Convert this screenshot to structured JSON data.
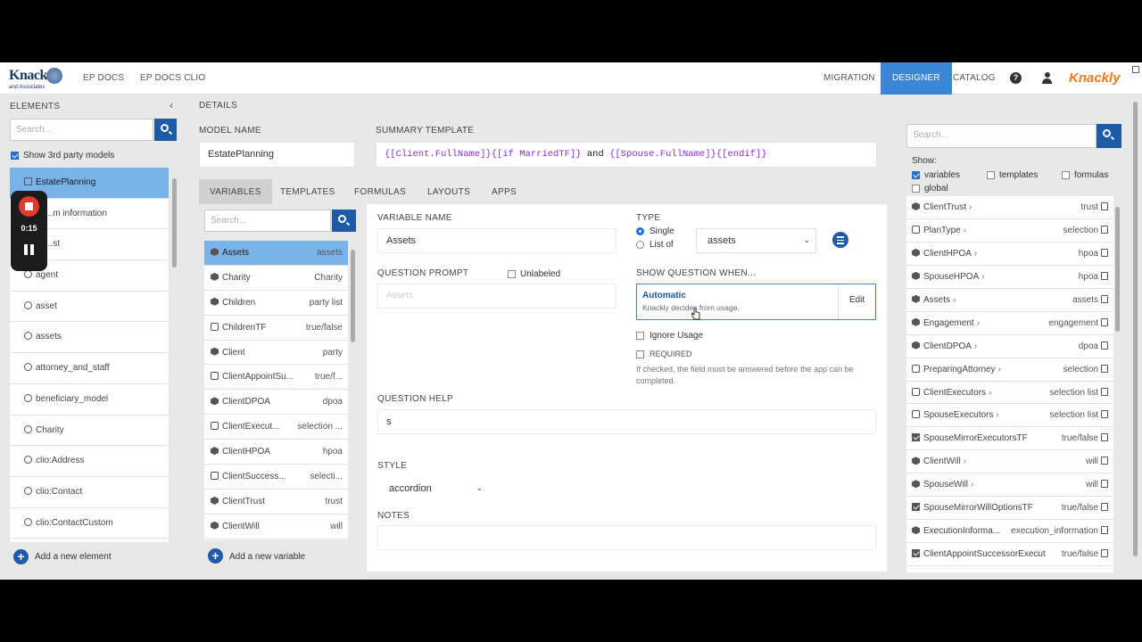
{
  "nav": {
    "logo_main": "Knack",
    "logo_sub": "and Associates",
    "links": [
      "EP DOCS",
      "EP DOCS CLIO"
    ],
    "right_links": [
      "MIGRATION",
      "DESIGNER",
      "CATALOG"
    ],
    "brand": "Knackly"
  },
  "left": {
    "title": "ELEMENTS",
    "collapse": "‹",
    "search_placeholder": "Search...",
    "show_3rd_party": "Show 3rd party models",
    "items": [
      {
        "label": "EstatePlanning",
        "icon": "table-icon"
      },
      {
        "label": "...m information",
        "icon": "circle-icon"
      },
      {
        "label": "...st",
        "icon": "circle-icon"
      },
      {
        "label": "agent",
        "icon": "circle-icon"
      },
      {
        "label": "asset",
        "icon": "circle-icon"
      },
      {
        "label": "assets",
        "icon": "circle-icon"
      },
      {
        "label": "attorney_and_staff",
        "icon": "circle-icon"
      },
      {
        "label": "beneficiary_model",
        "icon": "circle-icon"
      },
      {
        "label": "Charity",
        "icon": "circle-icon"
      },
      {
        "label": "clio:Address",
        "icon": "circle-icon"
      },
      {
        "label": "clio:Contact",
        "icon": "circle-icon"
      },
      {
        "label": "clio:ContactCustom",
        "icon": "circle-icon"
      }
    ],
    "add_label": "Add a new element"
  },
  "recorder": {
    "time": "0:15"
  },
  "details": {
    "title": "DETAILS",
    "model_name_label": "MODEL NAME",
    "model_name": "EstatePlanning",
    "summary_label": "SUMMARY TEMPLATE",
    "summary_parts": [
      "{[Client.FullName]}",
      "{[if MarriedTF]}",
      " and ",
      "{[Spouse.FullName]}",
      "{[endif]}"
    ],
    "expand": "›"
  },
  "tabs": [
    "VARIABLES",
    "TEMPLATES",
    "FORMULAS",
    "LAYOUTS",
    "APPS"
  ],
  "variables": {
    "search_placeholder": "Search...",
    "items": [
      {
        "name": "Assets",
        "type": "assets",
        "icon": "cube"
      },
      {
        "name": "Charity",
        "type": "Charity",
        "icon": "cube"
      },
      {
        "name": "Children",
        "type": "party list",
        "icon": "cube"
      },
      {
        "name": "ChildrenTF",
        "type": "true/false",
        "icon": "square"
      },
      {
        "name": "Client",
        "type": "party",
        "icon": "cube"
      },
      {
        "name": "ClientAppointSu...",
        "type": "true/f...",
        "icon": "square"
      },
      {
        "name": "ClientDPOA",
        "type": "dpoa",
        "icon": "cube"
      },
      {
        "name": "ClientExecut...",
        "type": "selection ...",
        "icon": "square"
      },
      {
        "name": "ClientHPOA",
        "type": "hpoa",
        "icon": "cube"
      },
      {
        "name": "ClientSuccess...",
        "type": "selecti...",
        "icon": "square"
      },
      {
        "name": "ClientTrust",
        "type": "trust",
        "icon": "cube"
      },
      {
        "name": "ClientWill",
        "type": "will",
        "icon": "cube"
      }
    ],
    "add_label": "Add a new variable"
  },
  "editor": {
    "var_name_label": "VARIABLE NAME",
    "var_name": "Assets",
    "type_label": "TYPE",
    "type_single": "Single",
    "type_list": "List of",
    "type_value": "assets",
    "prompt_label": "QUESTION PROMPT",
    "unlabeled": "Unlabeled",
    "prompt_placeholder": "Assets",
    "show_when_label": "SHOW QUESTION WHEN...",
    "auto_title": "Automatic",
    "auto_sub": "Knackly decides from usage.",
    "edit": "Edit",
    "ignore_usage": "Ignore Usage",
    "required": "REQUIRED",
    "required_hint": "If checked, the field must be answered before the app can be completed.",
    "help_label": "QUESTION HELP",
    "help_value": "s",
    "style_label": "STYLE",
    "style_value": "accordion",
    "notes_label": "NOTES"
  },
  "right": {
    "search_placeholder": "Search...",
    "show_label": "Show:",
    "opts": [
      "variables",
      "templates",
      "formulas",
      "global"
    ],
    "items": [
      {
        "name": "ClientTrust",
        "type": "trust",
        "icon": "cube",
        "chev": true
      },
      {
        "name": "PlanType",
        "type": "selection",
        "icon": "square",
        "chev": true
      },
      {
        "name": "ClientHPOA",
        "type": "hpoa",
        "icon": "cube",
        "chev": true
      },
      {
        "name": "SpouseHPOA",
        "type": "hpoa",
        "icon": "cube",
        "chev": true
      },
      {
        "name": "Assets",
        "type": "assets",
        "icon": "cube",
        "chev": true
      },
      {
        "name": "Engagement",
        "type": "engagement",
        "icon": "cube",
        "chev": true
      },
      {
        "name": "ClientDPOA",
        "type": "dpoa",
        "icon": "cube",
        "chev": true
      },
      {
        "name": "PreparingAttorney",
        "type": "selection",
        "icon": "square",
        "chev": true
      },
      {
        "name": "ClientExecutors",
        "type": "selection list",
        "icon": "square",
        "chev": true
      },
      {
        "name": "SpouseExecutors",
        "type": "selection list",
        "icon": "square",
        "chev": true
      },
      {
        "name": "SpouseMirrorExecutorsTF",
        "type": "true/false",
        "icon": "checkbox",
        "chev": false
      },
      {
        "name": "ClientWill",
        "type": "will",
        "icon": "cube",
        "chev": true
      },
      {
        "name": "SpouseWill",
        "type": "will",
        "icon": "cube",
        "chev": true
      },
      {
        "name": "SpouseMirrorWillOptionsTF",
        "type": "true/false",
        "icon": "checkbox",
        "chev": false
      },
      {
        "name": "ExecutionInforma...",
        "type": "execution_information",
        "icon": "cube",
        "chev": false
      },
      {
        "name": "ClientAppointSuccessorExecut...",
        "type": "true/false",
        "icon": "checkbox",
        "chev": false
      }
    ]
  }
}
